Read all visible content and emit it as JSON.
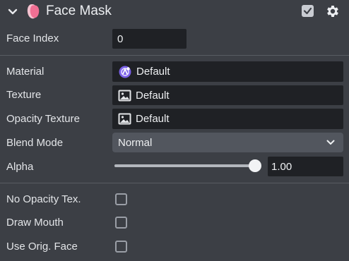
{
  "header": {
    "title": "Face Mask",
    "enabled": true
  },
  "fields": {
    "face_index": {
      "label": "Face Index",
      "value": "0"
    },
    "material": {
      "label": "Material",
      "value": "Default"
    },
    "texture": {
      "label": "Texture",
      "value": "Default"
    },
    "opacity_texture": {
      "label": "Opacity Texture",
      "value": "Default"
    },
    "blend_mode": {
      "label": "Blend Mode",
      "value": "Normal"
    },
    "alpha": {
      "label": "Alpha",
      "value": "1.00",
      "slider_fraction": 1.0
    },
    "no_opacity_tex": {
      "label": "No Opacity Tex.",
      "checked": false
    },
    "draw_mouth": {
      "label": "Draw Mouth",
      "checked": false
    },
    "use_orig_face": {
      "label": "Use Orig. Face",
      "checked": false
    }
  },
  "colors": {
    "panel_bg": "#3c3f45",
    "field_bg": "#1f2125",
    "dropdown_bg": "#52565e",
    "material_icon": "#7b61e8",
    "mask_icon": "#f06f93"
  }
}
